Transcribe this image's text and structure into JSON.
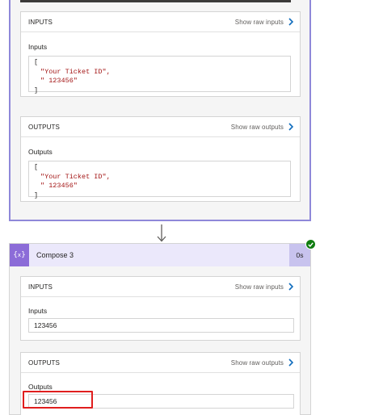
{
  "top_action": {
    "inputs_section": {
      "header": "INPUTS",
      "link": "Show raw inputs",
      "field_label": "Inputs",
      "code": {
        "open": "[",
        "line1": "\"Your Ticket ID\",",
        "line2": "\" 123456\"",
        "close": "]"
      }
    },
    "outputs_section": {
      "header": "OUTPUTS",
      "link": "Show raw outputs",
      "field_label": "Outputs",
      "code": {
        "open": "[",
        "line1": "\"Your Ticket ID\",",
        "line2": "\" 123456\"",
        "close": "]"
      }
    }
  },
  "compose3": {
    "icon": "compose-icon",
    "title": "Compose 3",
    "duration": "0s",
    "status": "succeeded",
    "status_color": "#107c10",
    "inputs_section": {
      "header": "INPUTS",
      "link": "Show raw inputs",
      "field_label": "Inputs",
      "value": "123456"
    },
    "outputs_section": {
      "header": "OUTPUTS",
      "link": "Show raw outputs",
      "field_label": "Outputs",
      "value": "123456"
    }
  },
  "colors": {
    "accent_border": "#8f88d9",
    "compose_header_bg": "#ebe8fb",
    "compose_icon_bg": "#8c6cd8",
    "link_chevron": "#0f6cbd",
    "highlight": "#e01e1e",
    "string_literal": "#a31515"
  }
}
